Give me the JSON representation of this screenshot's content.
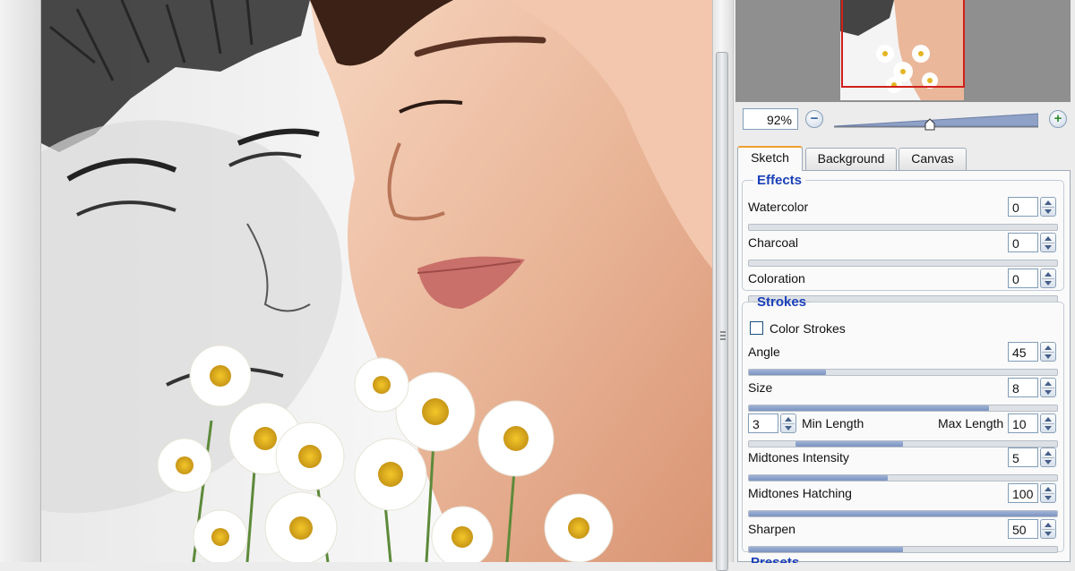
{
  "navigator": {
    "zoom_value": "92%",
    "zoom_level": 0.47
  },
  "tabs": [
    {
      "label": "Sketch",
      "active": true
    },
    {
      "label": "Background",
      "active": false
    },
    {
      "label": "Canvas",
      "active": false
    }
  ],
  "effects": {
    "title": "Effects",
    "params": [
      {
        "label": "Watercolor",
        "value": "0",
        "fraction": 0.0
      },
      {
        "label": "Charcoal",
        "value": "0",
        "fraction": 0.0
      },
      {
        "label": "Coloration",
        "value": "0",
        "fraction": 0.0
      }
    ]
  },
  "strokes": {
    "title": "Strokes",
    "color_strokes_label": "Color Strokes",
    "color_strokes_checked": false,
    "angle": {
      "label": "Angle",
      "value": "45",
      "fraction": 0.25
    },
    "size": {
      "label": "Size",
      "value": "8",
      "fraction": 0.78
    },
    "min_length": {
      "label": "Min Length",
      "value": "3"
    },
    "max_length": {
      "label": "Max Length",
      "value": "10"
    },
    "length_range": [
      0.15,
      0.5
    ],
    "midtones_intensity": {
      "label": "Midtones Intensity",
      "value": "5",
      "fraction": 0.45
    },
    "midtones_hatching": {
      "label": "Midtones Hatching",
      "value": "100",
      "fraction": 1.0
    },
    "sharpen": {
      "label": "Sharpen",
      "value": "50",
      "fraction": 0.5
    }
  },
  "presets_title": "Presets",
  "colors": {
    "accent_blue": "#1a3fb8",
    "active_tab_marker": "#f0a030",
    "navigator_frame": "#d0201a"
  }
}
